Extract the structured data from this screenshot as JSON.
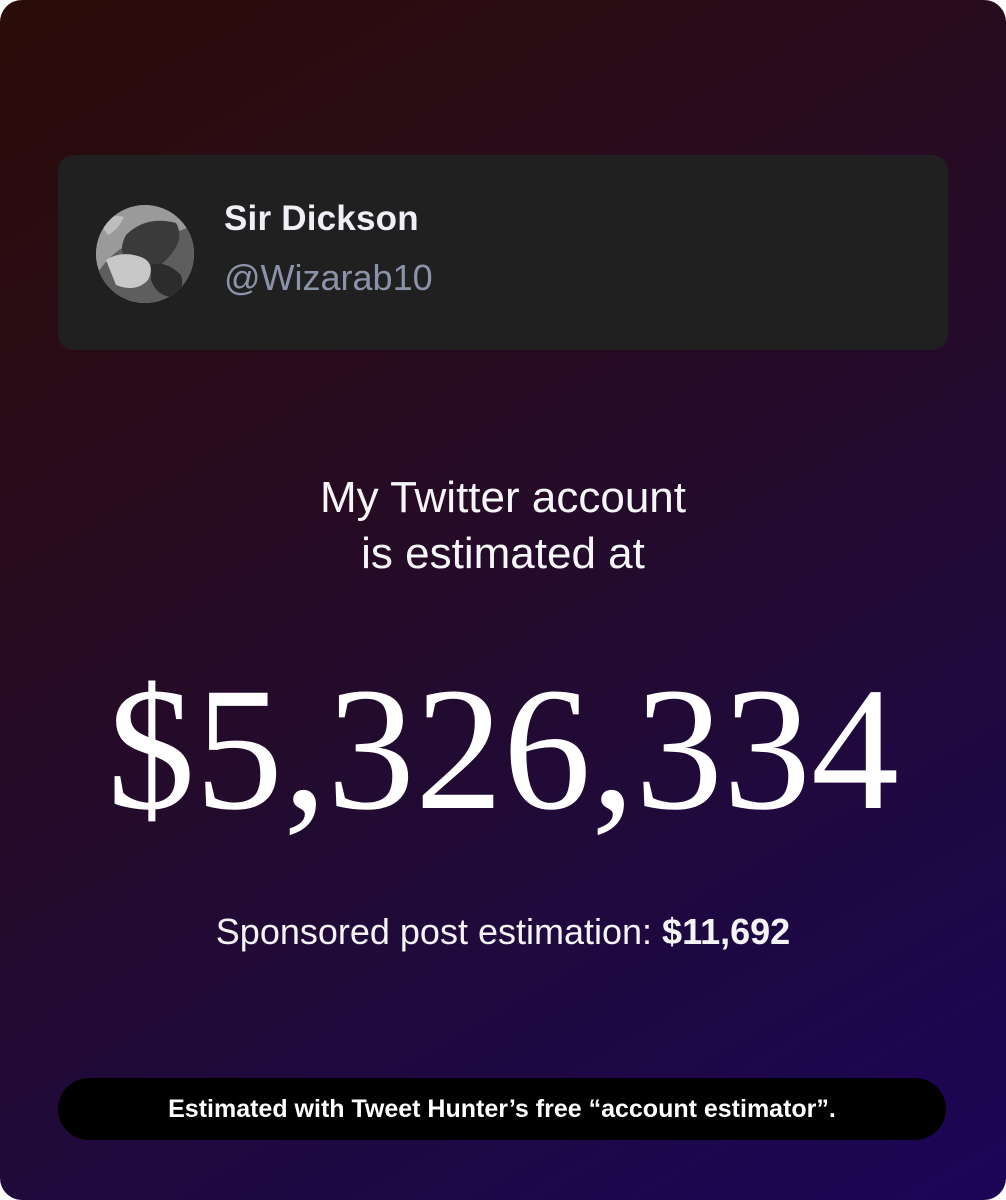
{
  "profile": {
    "display_name": "Sir Dickson",
    "handle": "@Wizarab10"
  },
  "headline": {
    "line1": "My Twitter account",
    "line2": "is estimated at"
  },
  "estimate": {
    "amount": "$5,326,334"
  },
  "sponsored": {
    "label": "Sponsored post estimation: ",
    "value": "$11,692"
  },
  "footer": {
    "text": "Estimated with Tweet Hunter’s free “account estimator”."
  }
}
